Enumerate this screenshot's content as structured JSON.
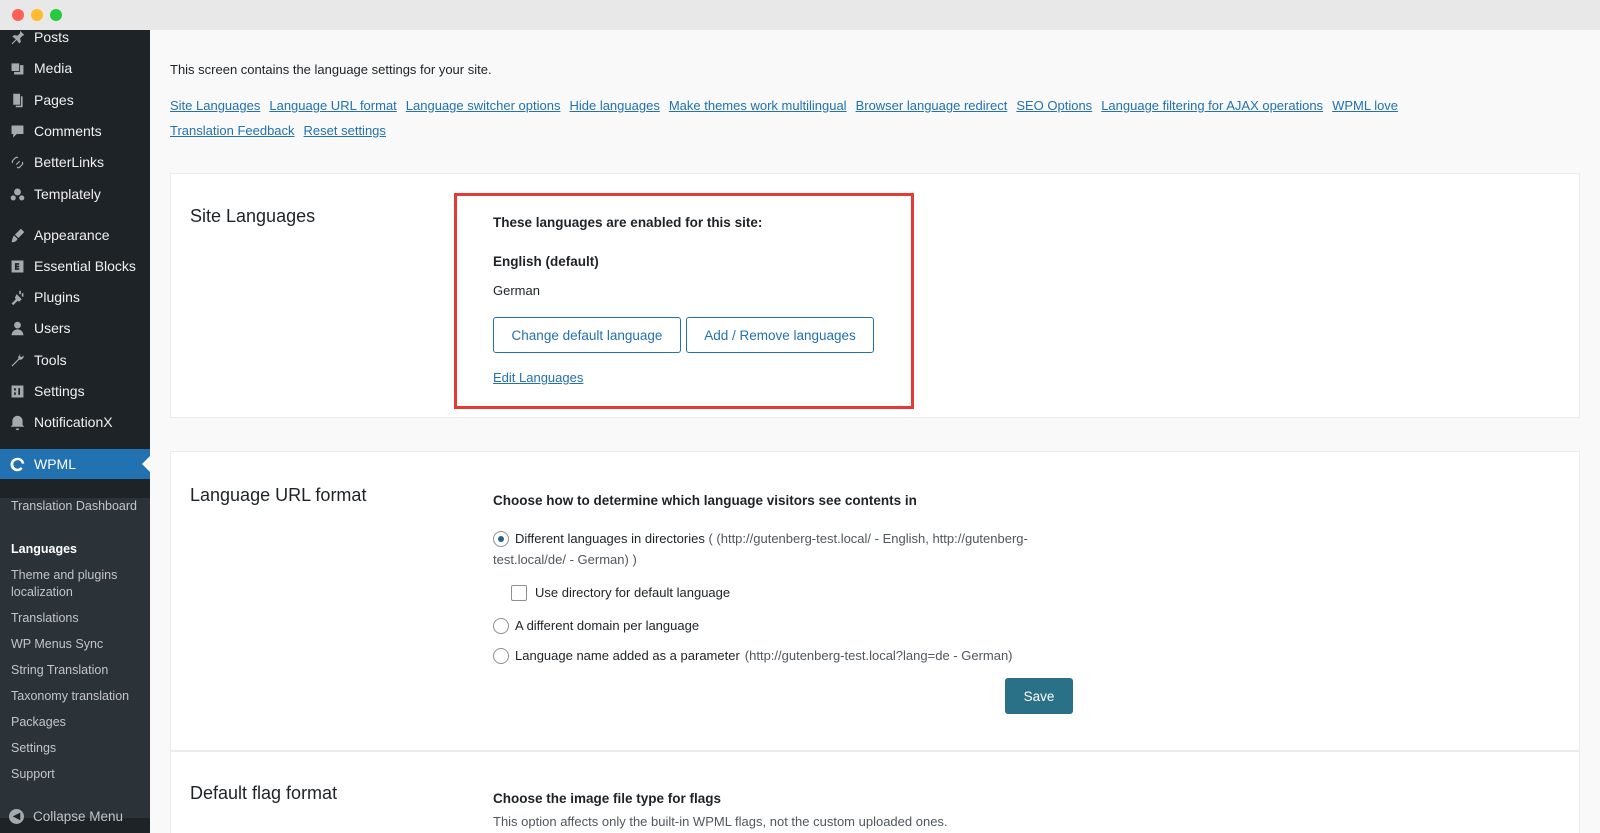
{
  "sidebar": {
    "items": [
      {
        "label": "Posts",
        "icon": "pin-icon"
      },
      {
        "label": "Media",
        "icon": "media-icon"
      },
      {
        "label": "Pages",
        "icon": "pages-icon"
      },
      {
        "label": "Comments",
        "icon": "comment-icon"
      },
      {
        "label": "BetterLinks",
        "icon": "link-icon"
      },
      {
        "label": "Templately",
        "icon": "templately-icon"
      },
      {
        "label": "Appearance",
        "icon": "brush-icon"
      },
      {
        "label": "Essential Blocks",
        "icon": "blocks-icon"
      },
      {
        "label": "Plugins",
        "icon": "plug-icon"
      },
      {
        "label": "Users",
        "icon": "user-icon"
      },
      {
        "label": "Tools",
        "icon": "wrench-icon"
      },
      {
        "label": "Settings",
        "icon": "sliders-icon"
      },
      {
        "label": "NotificationX",
        "icon": "notification-icon"
      },
      {
        "label": "WPML",
        "icon": "wpml-icon"
      }
    ],
    "submenu": [
      "Translation Dashboard",
      "Languages",
      "Theme and plugins localization",
      "Translations",
      "WP Menus Sync",
      "String Translation",
      "Taxonomy translation",
      "Packages",
      "Settings",
      "Support"
    ],
    "collapse_label": "Collapse Menu"
  },
  "main": {
    "intro": "This screen contains the language settings for your site.",
    "links": [
      "Site Languages",
      "Language URL format",
      "Language switcher options",
      "Hide languages",
      "Make themes work multilingual",
      "Browser language redirect",
      "SEO Options",
      "Language filtering for AJAX operations",
      "WPML love",
      "Translation Feedback",
      "Reset settings"
    ],
    "site_languages": {
      "title": "Site Languages",
      "enabled_heading": "These languages are enabled for this site:",
      "default_language": "English (default)",
      "other_language": "German",
      "change_default_button": "Change default language",
      "add_remove_button": "Add / Remove languages",
      "edit_link": "Edit Languages"
    },
    "url_format": {
      "title": "Language URL format",
      "heading": "Choose how to determine which language visitors see contents in",
      "option_directories_label": "Different languages in directories",
      "option_directories_hint_line1": "( (http://gutenberg-test.local/ - English, http://gutenberg-",
      "option_directories_hint_line2": "test.local/de/ - German) )",
      "use_directory_label": "Use directory for default language",
      "option_domain_label": "A different domain per language",
      "option_parameter_label": "Language name added as a parameter",
      "option_parameter_hint": "(http://gutenberg-test.local?lang=de - German)",
      "save_button": "Save"
    },
    "flag_format": {
      "title": "Default flag format",
      "heading": "Choose the image file type for flags",
      "description": "This option affects only the built-in WPML flags, not the custom uploaded ones."
    }
  },
  "colors": {
    "sidebar_bg": "#1d2327",
    "active_menu": "#2271b1",
    "link": "#2271b1",
    "save_button": "#2a7187",
    "highlight_border": "#e53935"
  }
}
